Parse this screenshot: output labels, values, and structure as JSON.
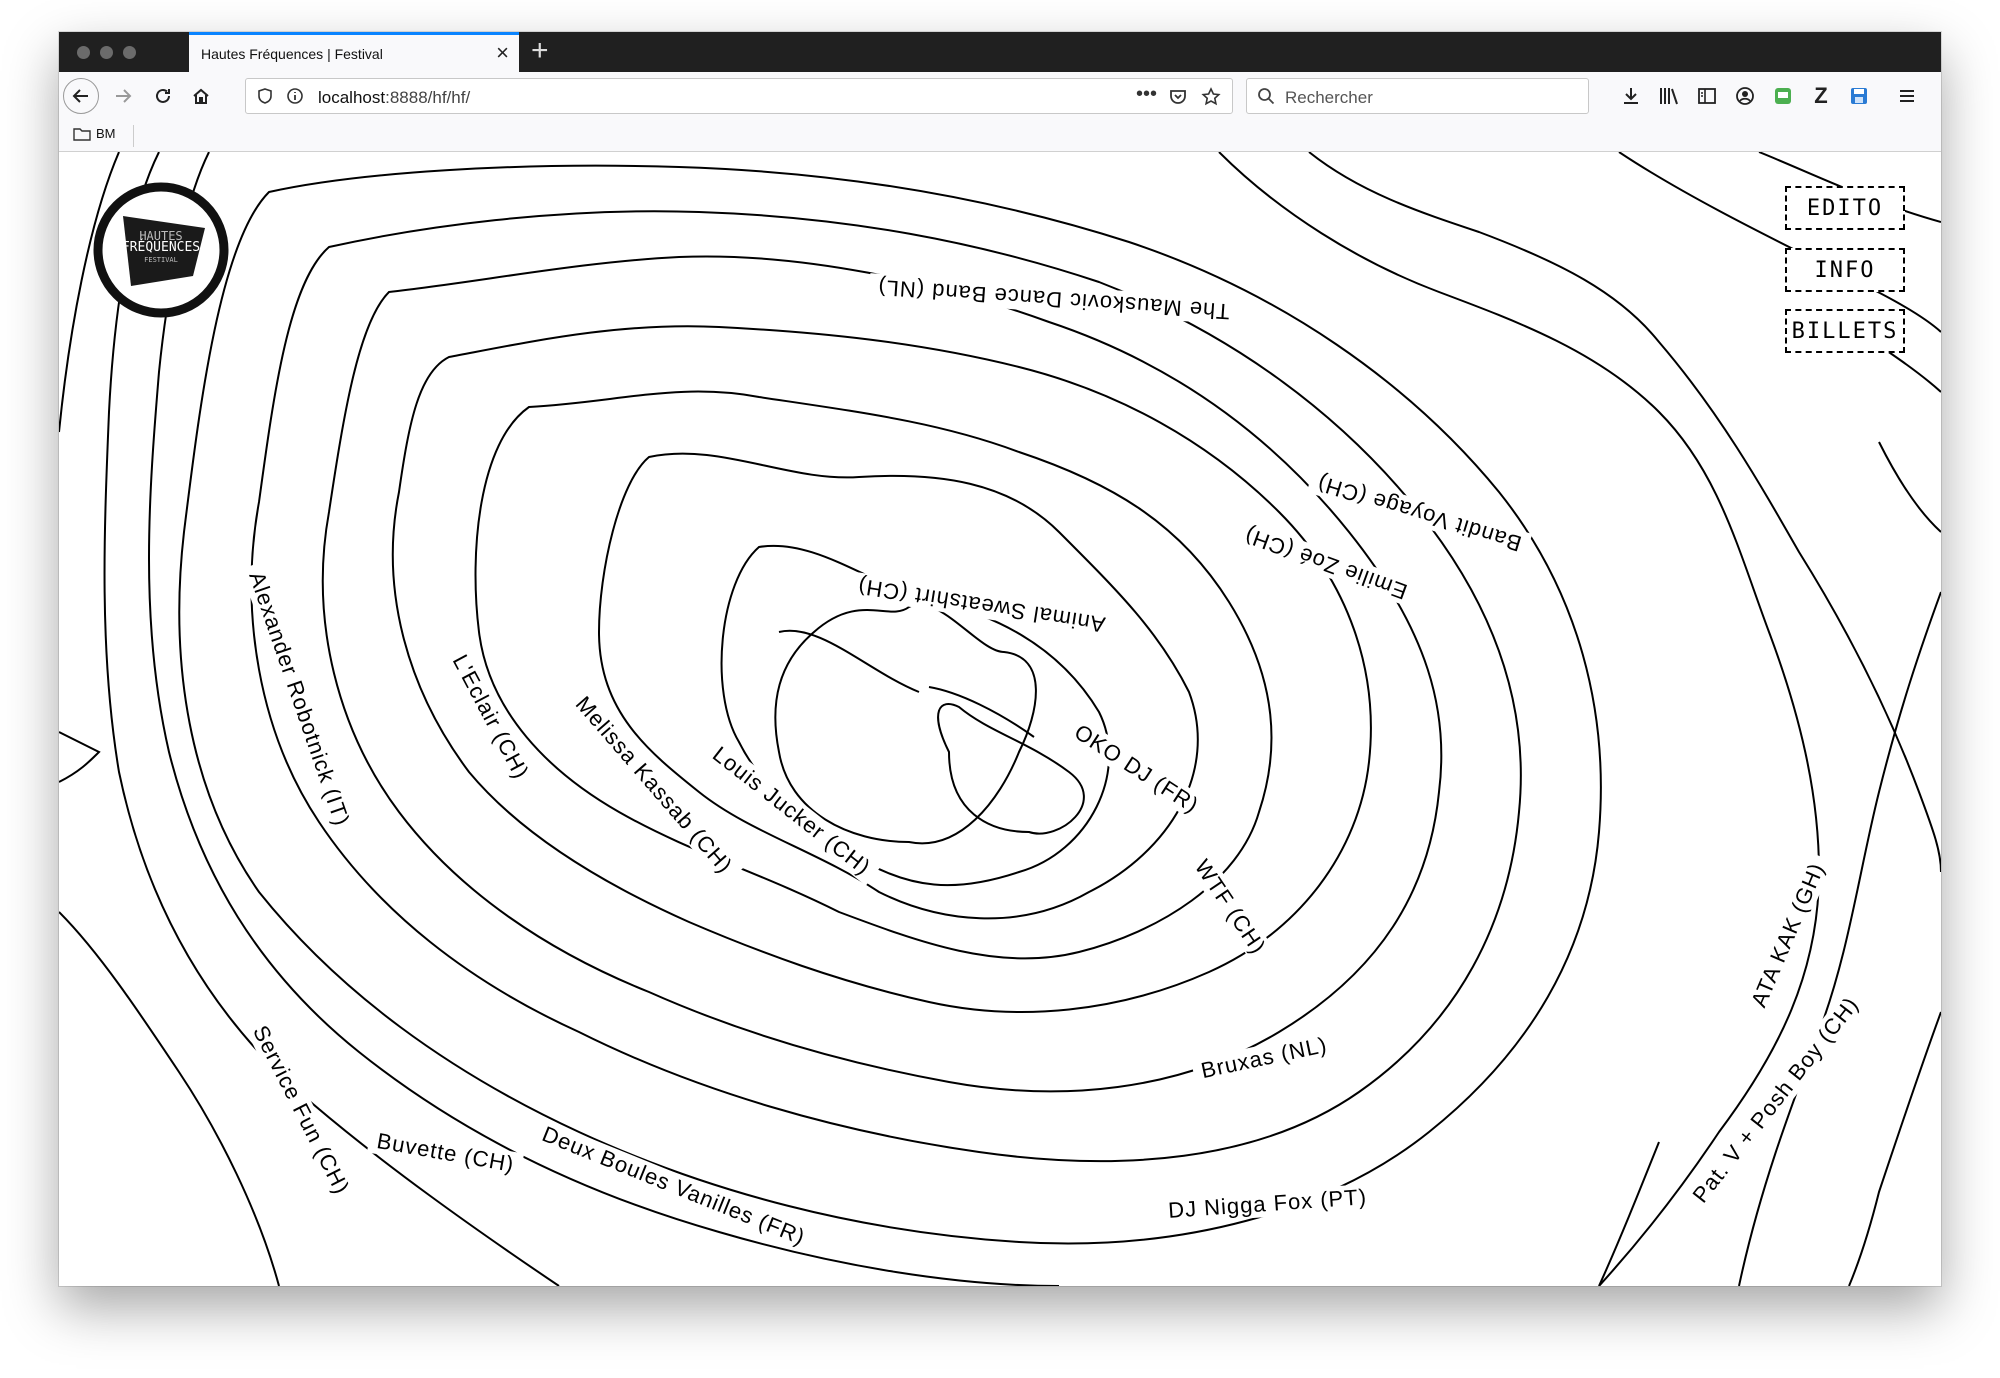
{
  "browser": {
    "tab_title": "Hautes Fréquences | Festival",
    "url_host": "localhost",
    "url_rest": ":8888/hf/hf/",
    "search_placeholder": "Rechercher",
    "bookmark_label": "BM"
  },
  "site": {
    "logo_line1": "HAUTES",
    "logo_line2": "FRÉQUENCES",
    "logo_line3": "FESTIVAL",
    "menu": [
      "EDITO",
      "INFO",
      "BILLETS"
    ],
    "artists": [
      "The Mauskovic Dance Band (NL)",
      "Bandit Voyage (CH)",
      "Emilie Zoé (CH)",
      "Animal Sweatshirt (CH)",
      "Alexander Robotnick (IT)",
      "L'Eclair (CH)",
      "Melissa Kassab (CH)",
      "Louis Jucker (CH)",
      "OKO DJ (FR)",
      "WTF (CH)",
      "ATA KAK (GH)",
      "Pat. V + Posh Boy (CH)",
      "Bruxas (NL)",
      "DJ Nigga Fox (PT)",
      "Service Fun (CH)",
      "Buvette (CH)",
      "Deux Boules Vanilles (FR)"
    ]
  }
}
